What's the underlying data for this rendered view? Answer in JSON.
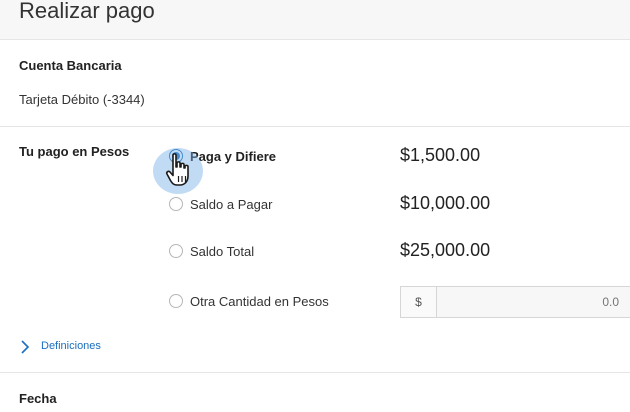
{
  "header": {
    "title": "Realizar pago"
  },
  "bank": {
    "label": "Cuenta Bancaria",
    "account": "Tarjeta Débito (-3344)"
  },
  "payment": {
    "label": "Tu pago en Pesos",
    "options": [
      {
        "label": "Paga y Difiere",
        "amount": "$1,500.00",
        "selected": true
      },
      {
        "label": "Saldo a Pagar",
        "amount": "$10,000.00",
        "selected": false
      },
      {
        "label": "Saldo Total",
        "amount": "$25,000.00",
        "selected": false
      },
      {
        "label": "Otra Cantidad en Pesos",
        "amount": "",
        "selected": false
      }
    ],
    "other_amount": {
      "currency": "$",
      "placeholder": "0.0"
    },
    "definitions_link": "Definiciones"
  },
  "date": {
    "label": "Fecha"
  },
  "colors": {
    "accent": "#1b6ec2",
    "divider": "#e6e6e6",
    "header_bg": "#f7f7f7"
  }
}
